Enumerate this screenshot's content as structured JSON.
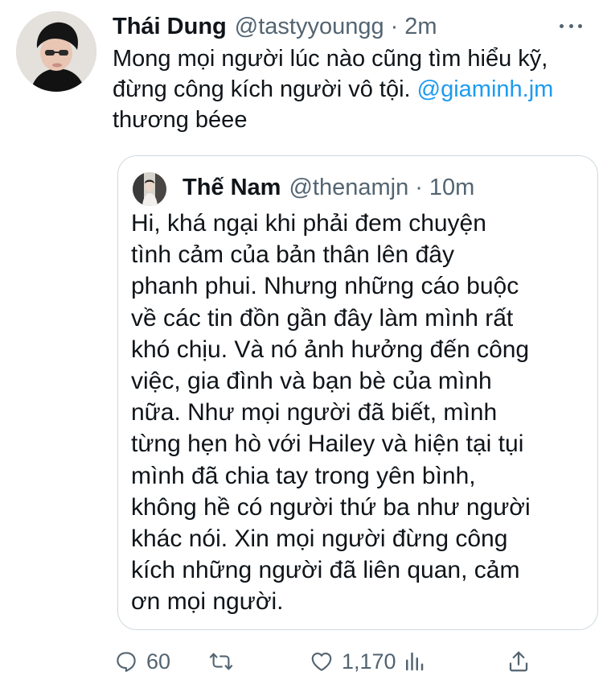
{
  "tweet": {
    "author": {
      "display_name": "Thái Dung",
      "handle": "@tastyyoungg"
    },
    "separator": "·",
    "time": "2m",
    "text_before": "Mong mọi người lúc nào cũng tìm hiểu kỹ, đừng công kích người vô tội.",
    "mention": "@giaminh.jm",
    "text_after": " thương béee",
    "more_icon": "more-horizontal-icon"
  },
  "quoted_tweet": {
    "author": {
      "display_name": "Thế Nam",
      "handle": "@thenamjn"
    },
    "separator": "·",
    "time": "10m",
    "lines": [
      "Hi, khá ngại khi phải đem chuyện",
      "tình cảm của bản thân lên đây",
      "phanh phui. Nhưng những cáo buộc",
      "về các tin đồn gần đây làm mình rất",
      "khó chịu. Và nó ảnh hưởng đến công",
      "việc, gia đình và bạn bè của mình",
      "nữa. Như mọi người đã biết, mình",
      "từng hẹn hò với Hailey và hiện tại tụi",
      "mình đã chia tay trong yên bình,",
      "không hề có người thứ ba như người",
      "khác nói. Xin mọi người đừng công",
      "kích những người đã liên quan, cảm",
      "ơn mọi người."
    ]
  },
  "actions": {
    "reply": {
      "icon": "reply-icon",
      "count": "60"
    },
    "retweet": {
      "icon": "retweet-icon",
      "count": ""
    },
    "like": {
      "icon": "heart-icon",
      "count": "1,170"
    },
    "analytics": {
      "icon": "analytics-icon"
    },
    "share": {
      "icon": "share-icon"
    }
  },
  "colors": {
    "text": "#0f1419",
    "secondary": "#536471",
    "link": "#1d9bf0",
    "border": "#cfd9de"
  }
}
